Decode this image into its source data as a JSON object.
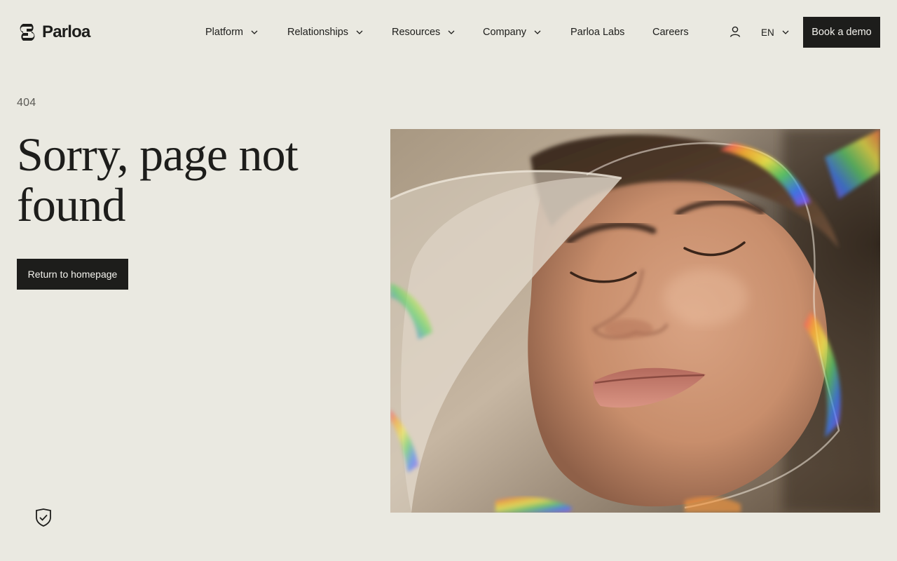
{
  "header": {
    "logo": {
      "text": "Parloa",
      "icon": "parloa-logo-icon"
    },
    "nav": [
      {
        "label": "Platform",
        "has_dropdown": true
      },
      {
        "label": "Relationships",
        "has_dropdown": true
      },
      {
        "label": "Resources",
        "has_dropdown": true
      },
      {
        "label": "Company",
        "has_dropdown": true
      },
      {
        "label": "Parloa Labs",
        "has_dropdown": false
      },
      {
        "label": "Careers",
        "has_dropdown": false
      }
    ],
    "account_icon": "user-icon",
    "language": {
      "label": "EN",
      "icon": "chevron-down-icon"
    },
    "cta_label": "Book a demo"
  },
  "main": {
    "code": "404",
    "title": "Sorry, page not found",
    "button_label": "Return to homepage"
  },
  "hero_image": {
    "subject": "woman-with-closed-eyes-prism-light-photo"
  },
  "privacy": {
    "icon": "shield-check-icon"
  },
  "colors": {
    "background": "#eae9e1",
    "text": "#1d1d1b",
    "button_bg": "#1d1d1b",
    "button_text": "#f4f3ee",
    "muted": "#5b5a55"
  }
}
